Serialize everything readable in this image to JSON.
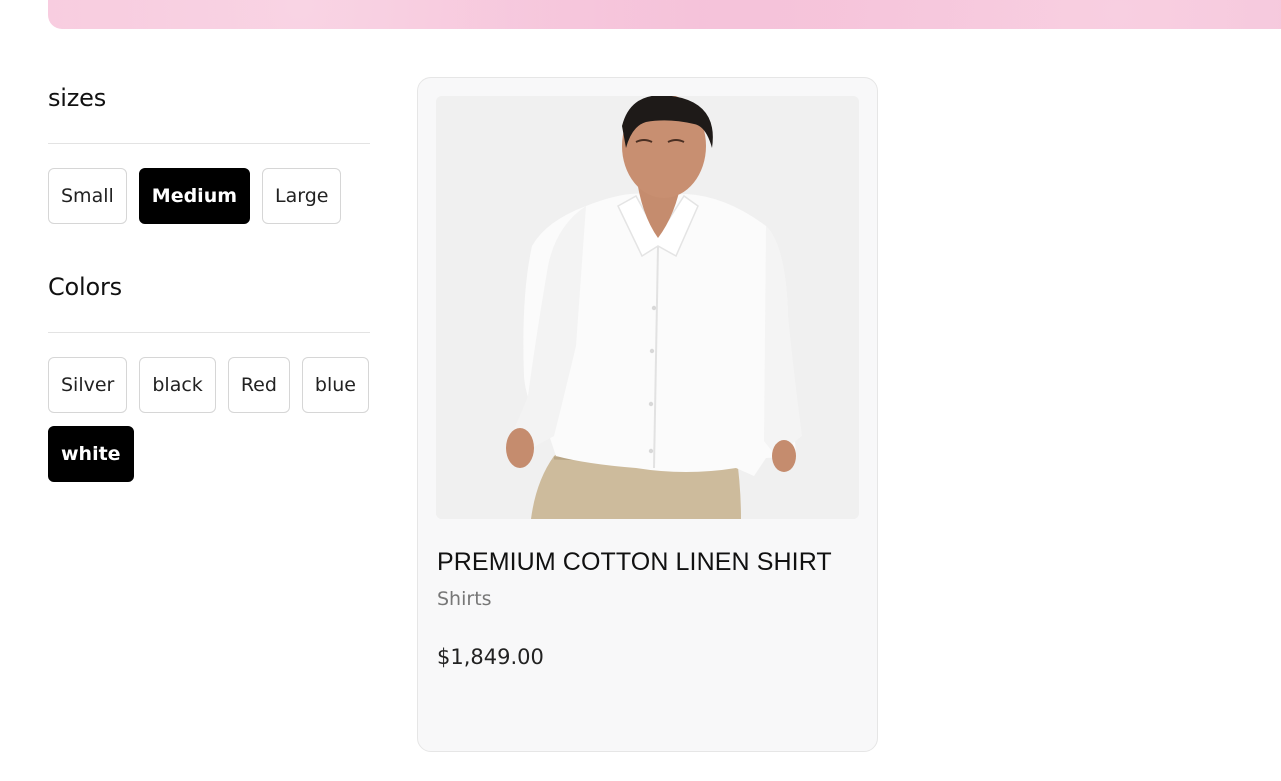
{
  "filters": {
    "sizes": {
      "title": "sizes",
      "options": [
        {
          "label": "Small",
          "selected": false
        },
        {
          "label": "Medium",
          "selected": true
        },
        {
          "label": "Large",
          "selected": false
        }
      ]
    },
    "colors": {
      "title": "Colors",
      "options": [
        {
          "label": "Silver",
          "selected": false
        },
        {
          "label": "black",
          "selected": false
        },
        {
          "label": "Red",
          "selected": false
        },
        {
          "label": "blue",
          "selected": false
        },
        {
          "label": "white",
          "selected": true
        }
      ]
    }
  },
  "product": {
    "title": "PREMIUM COTTON LINEN SHIRT",
    "category": "Shirts",
    "price": "$1,849.00"
  },
  "theme": {
    "banner_pink": "#f6c6dc",
    "chip_active_bg": "#000000",
    "card_bg": "#f8f8f9"
  }
}
